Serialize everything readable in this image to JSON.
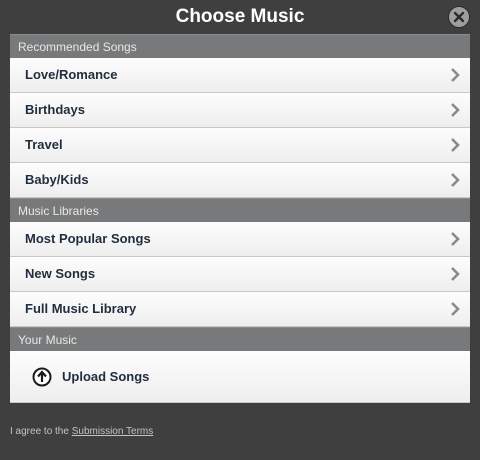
{
  "dialog": {
    "title": "Choose Music"
  },
  "sections": [
    {
      "header": "Recommended Songs",
      "items": [
        "Love/Romance",
        "Birthdays",
        "Travel",
        "Baby/Kids"
      ]
    },
    {
      "header": "Music Libraries",
      "items": [
        "Most Popular Songs",
        "New Songs",
        "Full Music Library"
      ]
    },
    {
      "header": "Your Music",
      "upload_label": "Upload Songs"
    }
  ],
  "footer": {
    "text": "I agree to the",
    "link": "Submission Terms"
  },
  "colors": {
    "background": "#3f3f3f",
    "section_header": "#78797a",
    "item_text": "#1f2d3d",
    "chevron": "#8a8a8a"
  },
  "icons": {
    "close": "close-icon",
    "row_arrow": "chevron-right-icon",
    "upload": "arrow-up-circle-icon"
  }
}
